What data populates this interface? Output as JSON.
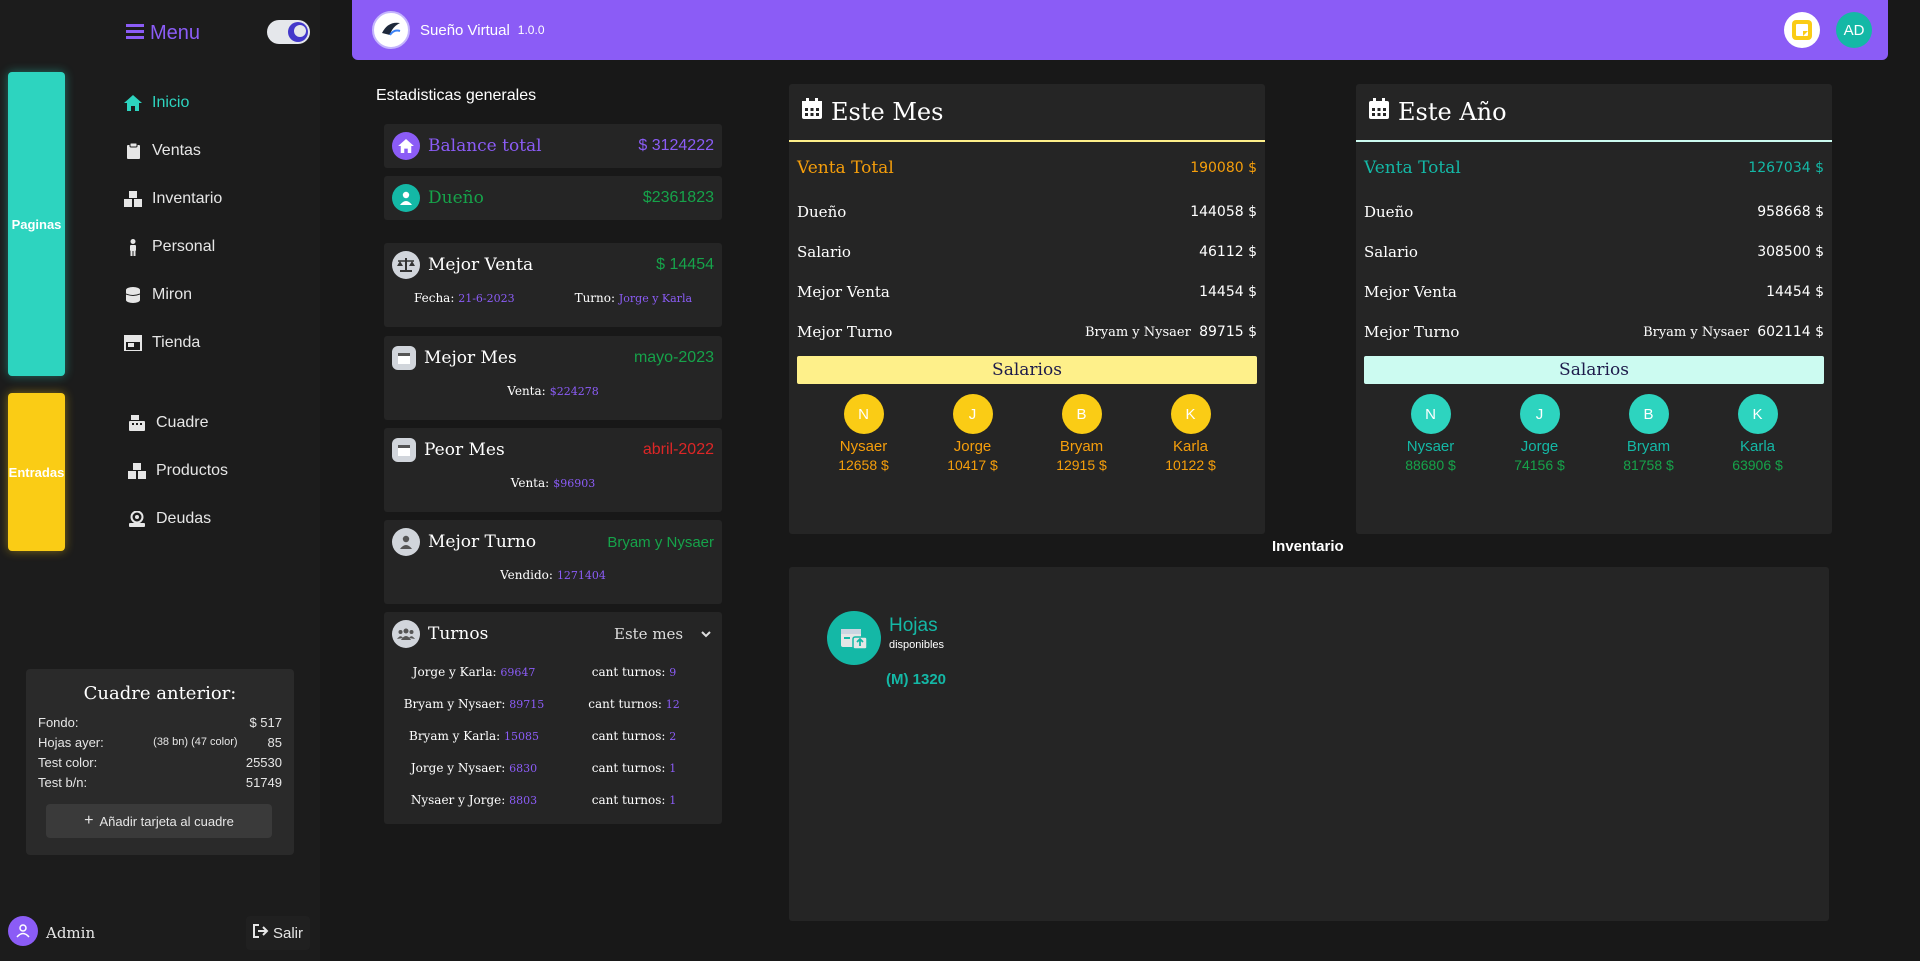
{
  "sidebar": {
    "menu_label": "Menu",
    "tab_paginas": "Paginas",
    "tab_entradas": "Entradas",
    "nav_pages": [
      {
        "label": "Inicio",
        "icon": "home-icon"
      },
      {
        "label": "Ventas",
        "icon": "clipboard-icon"
      },
      {
        "label": "Inventario",
        "icon": "boxes-icon"
      },
      {
        "label": "Personal",
        "icon": "person-icon"
      },
      {
        "label": "Miron",
        "icon": "database-icon"
      },
      {
        "label": "Tienda",
        "icon": "store-icon"
      }
    ],
    "nav_entries": [
      {
        "label": "Cuadre",
        "icon": "cash-register-icon"
      },
      {
        "label": "Productos",
        "icon": "boxes-icon"
      },
      {
        "label": "Deudas",
        "icon": "debt-icon"
      }
    ],
    "cuadre": {
      "title": "Cuadre anterior:",
      "fondo_label": "Fondo:",
      "fondo_value": "$ 517",
      "hojas_label": "Hojas ayer:",
      "hojas_detail": "(38 bn) (47 color)",
      "hojas_value": "85",
      "test_color_label": "Test color:",
      "test_color_value": "25530",
      "test_bn_label": "Test b/n:",
      "test_bn_value": "51749",
      "add_button": "Añadir tarjeta al cuadre"
    },
    "user_name": "Admin",
    "logout_label": "Salir"
  },
  "header": {
    "app_name": "Sueño Virtual",
    "version": "1.0.0",
    "user_initials": "AD"
  },
  "stats": {
    "title": "Estadisticas generales",
    "balance_label": "Balance total",
    "balance_value": "3124222",
    "owner_label": "Dueño",
    "owner_value": "$2361823",
    "best_sale_label": "Mejor Venta",
    "best_sale_value": "14454",
    "best_sale_date_label": "Fecha:",
    "best_sale_date": "21-6-2023",
    "best_sale_shift_label": "Turno:",
    "best_sale_shift": "Jorge y Karla",
    "best_month_label": "Mejor Mes",
    "best_month_value": "mayo-2023",
    "best_month_sale_label": "Venta:",
    "best_month_sale": "$224278",
    "worst_month_label": "Peor Mes",
    "worst_month_value": "abril-2022",
    "worst_month_sale_label": "Venta:",
    "worst_month_sale": "$96903",
    "best_shift_label": "Mejor Turno",
    "best_shift_value": "Bryam y Nysaer",
    "best_shift_sold_label": "Vendido:",
    "best_shift_sold": "1271404",
    "turnos_label": "Turnos",
    "turnos_selected": "Este mes",
    "count_label": "cant turnos:",
    "turnos": [
      {
        "name": "Jorge y Karla:",
        "amount": "69647",
        "count": "9"
      },
      {
        "name": "Bryam y Nysaer:",
        "amount": "89715",
        "count": "12"
      },
      {
        "name": "Bryam y Karla:",
        "amount": "15085",
        "count": "2"
      },
      {
        "name": "Jorge y Nysaer:",
        "amount": "6830",
        "count": "1"
      },
      {
        "name": "Nysaer y Jorge:",
        "amount": "8803",
        "count": "1"
      }
    ]
  },
  "month": {
    "title": "Este Mes",
    "venta_total_label": "Venta Total",
    "venta_total": "190080 $",
    "owner_label": "Dueño",
    "owner": "144058 $",
    "salary_label": "Salario",
    "salary": "46112 $",
    "best_sale_label": "Mejor Venta",
    "best_sale": "14454 $",
    "best_shift_label": "Mejor Turno",
    "best_shift_names": "Bryam y Nysaer",
    "best_shift": "89715 $",
    "salarios_label": "Salarios",
    "people": [
      {
        "initial": "N",
        "name": "Nysaer",
        "value": "12658 $"
      },
      {
        "initial": "J",
        "name": "Jorge",
        "value": "10417 $"
      },
      {
        "initial": "B",
        "name": "Bryam",
        "value": "12915 $"
      },
      {
        "initial": "K",
        "name": "Karla",
        "value": "10122 $"
      }
    ]
  },
  "year": {
    "title": "Este Año",
    "venta_total_label": "Venta Total",
    "venta_total": "1267034 $",
    "owner_label": "Dueño",
    "owner": "958668 $",
    "salary_label": "Salario",
    "salary": "308500 $",
    "best_sale_label": "Mejor Venta",
    "best_sale": "14454 $",
    "best_shift_label": "Mejor Turno",
    "best_shift_names": "Bryam y Nysaer",
    "best_shift": "602114 $",
    "salarios_label": "Salarios",
    "people": [
      {
        "initial": "N",
        "name": "Nysaer",
        "value": "88680 $"
      },
      {
        "initial": "J",
        "name": "Jorge",
        "value": "74156 $"
      },
      {
        "initial": "B",
        "name": "Bryam",
        "value": "81758 $"
      },
      {
        "initial": "K",
        "name": "Karla",
        "value": "63906 $"
      }
    ]
  },
  "inventory": {
    "title": "Inventario",
    "item_name": "Hojas",
    "item_sub": "disponibles",
    "item_qty": "(M) 1320"
  },
  "colors": {
    "accent_purple": "#8b5cf6",
    "accent_teal": "#2dd4bf",
    "accent_yellow": "#facc15"
  }
}
